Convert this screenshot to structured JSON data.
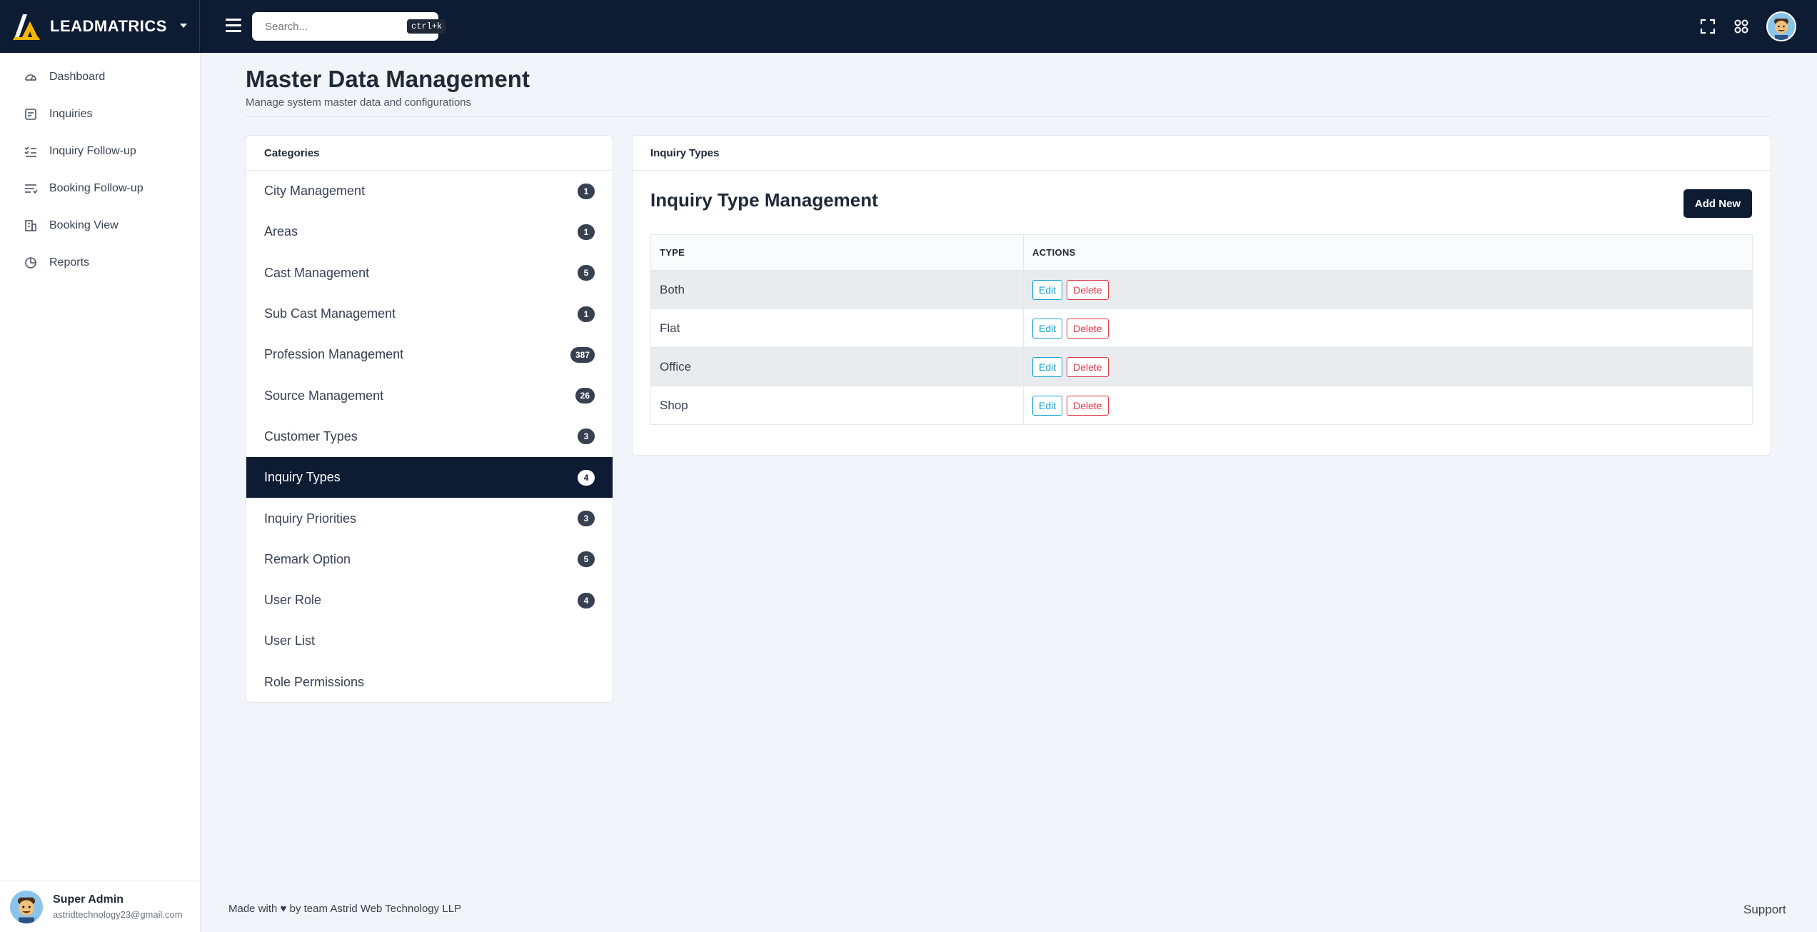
{
  "brand": {
    "name": "LEADMATRICS"
  },
  "search": {
    "placeholder": "Search...",
    "shortcut": "ctrl+k"
  },
  "sidebar": {
    "items": [
      {
        "label": "Dashboard",
        "icon": "gauge-icon"
      },
      {
        "label": "Inquiries",
        "icon": "clipboard-icon"
      },
      {
        "label": "Inquiry Follow-up",
        "icon": "checklist-icon"
      },
      {
        "label": "Booking Follow-up",
        "icon": "list-filter-icon"
      },
      {
        "label": "Booking View",
        "icon": "building-icon"
      },
      {
        "label": "Reports",
        "icon": "chart-pie-icon"
      }
    ],
    "user": {
      "name": "Super Admin",
      "email": "astridtechnology23@gmail.com"
    }
  },
  "page": {
    "title": "Master Data Management",
    "subtitle": "Manage system master data and configurations"
  },
  "categories": {
    "header": "Categories",
    "items": [
      {
        "label": "City Management",
        "count": "1"
      },
      {
        "label": "Areas",
        "count": "1"
      },
      {
        "label": "Cast Management",
        "count": "5"
      },
      {
        "label": "Sub Cast Management",
        "count": "1"
      },
      {
        "label": "Profession Management",
        "count": "387"
      },
      {
        "label": "Source Management",
        "count": "26"
      },
      {
        "label": "Customer Types",
        "count": "3"
      },
      {
        "label": "Inquiry Types",
        "count": "4",
        "active": true
      },
      {
        "label": "Inquiry Priorities",
        "count": "3"
      },
      {
        "label": "Remark Option",
        "count": "5"
      },
      {
        "label": "User Role",
        "count": "4"
      },
      {
        "label": "User List",
        "count": ""
      },
      {
        "label": "Role Permissions",
        "count": ""
      }
    ]
  },
  "main": {
    "header": "Inquiry Types",
    "title": "Inquiry Type Management",
    "add_button": "Add New",
    "columns": [
      "TYPE",
      "ACTIONS"
    ],
    "edit_label": "Edit",
    "delete_label": "Delete",
    "rows": [
      {
        "type": "Both"
      },
      {
        "type": "Flat"
      },
      {
        "type": "Office"
      },
      {
        "type": "Shop"
      }
    ]
  },
  "footer": {
    "prefix": "Made with",
    "heart": "♥",
    "suffix": "by team Astrid Web Technology LLP",
    "support": "Support"
  },
  "colors": {
    "navy": "#0d1b33",
    "accent_yellow": "#f5b500",
    "edit_blue": "#17a2d6",
    "delete_red": "#dc3545"
  }
}
